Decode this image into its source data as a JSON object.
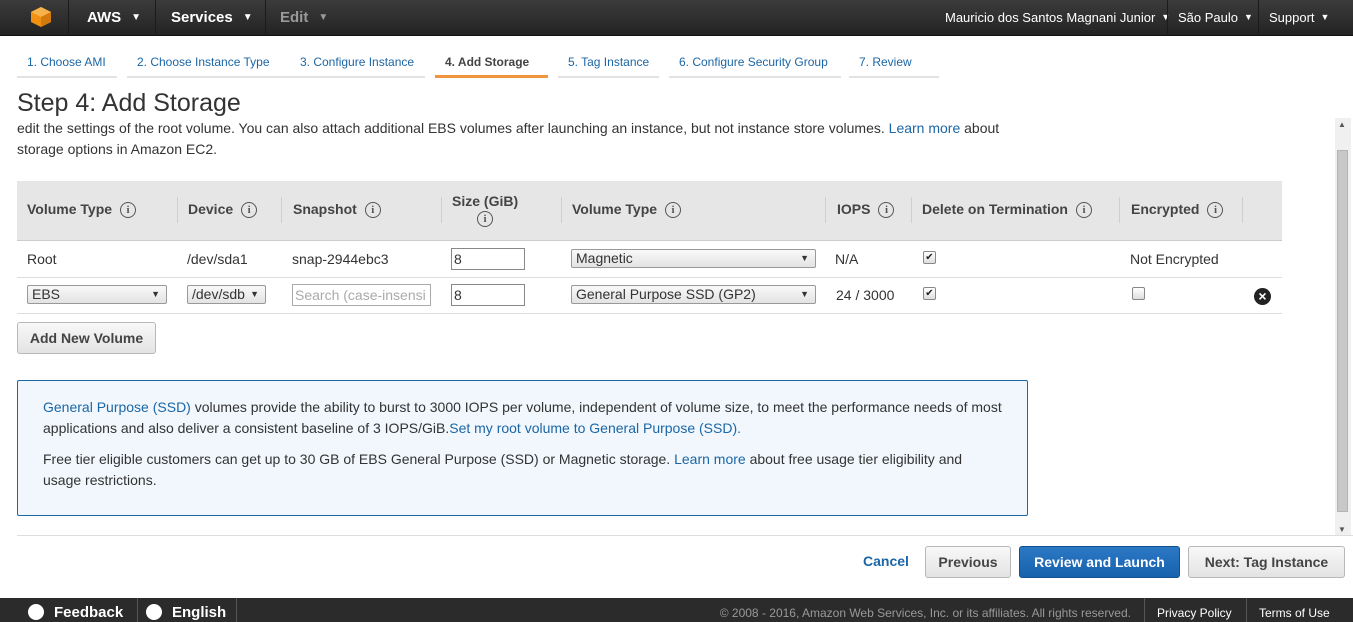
{
  "topnav": {
    "aws_label": "AWS",
    "services_label": "Services",
    "edit_label": "Edit",
    "user_label": "Mauricio dos Santos Magnani Junior",
    "region_label": "São Paulo",
    "support_label": "Support"
  },
  "tabs": [
    {
      "label": "1. Choose AMI"
    },
    {
      "label": "2. Choose Instance Type"
    },
    {
      "label": "3. Configure Instance"
    },
    {
      "label": "4. Add Storage"
    },
    {
      "label": "5. Tag Instance"
    },
    {
      "label": "6. Configure Security Group"
    },
    {
      "label": "7. Review"
    }
  ],
  "page_title": "Step 4: Add Storage",
  "description": {
    "text1": "edit the settings of the root volume. You can also attach additional EBS volumes after launching an instance, but not instance store volumes.",
    "link": "Learn more",
    "text2": "about storage options in Amazon EC2."
  },
  "table": {
    "headers": {
      "volume_type": "Volume Type",
      "device": "Device",
      "snapshot": "Snapshot",
      "size": "Size (GiB)",
      "volume_type2": "Volume Type",
      "iops": "IOPS",
      "delete_on_termination": "Delete on Termination",
      "encrypted": "Encrypted"
    },
    "info_glyph": "i",
    "rows": [
      {
        "volume_type": "Root",
        "device": "/dev/sda1",
        "snapshot": "snap-2944ebc3",
        "size": "8",
        "ebs_type": "Magnetic",
        "iops": "N/A",
        "delete_on_termination": true,
        "encrypted": "Not Encrypted"
      },
      {
        "volume_type": "EBS",
        "device": "/dev/sdb",
        "snapshot_placeholder": "Search (case-insensi",
        "size": "8",
        "ebs_type": "General Purpose SSD (GP2)",
        "iops": "24 / 3000",
        "delete_on_termination": true,
        "encrypted": false
      }
    ],
    "check_glyph": "✔",
    "remove_glyph": "×"
  },
  "add_volume_label": "Add New Volume",
  "infobox": {
    "p1_link": "General Purpose (SSD)",
    "p1_text": "volumes provide the ability to burst to 3000 IOPS per volume, independent of volume size, to meet the performance needs of most applications and also deliver a consistent baseline of 3 IOPS/GiB.",
    "p1_link2": "Set my root volume to General Purpose (SSD).",
    "p2_text": "Free tier eligible customers can get up to 30 GB of EBS General Purpose (SSD) or Magnetic storage.",
    "p2_link": "Learn more",
    "p2_text2": "about free usage tier eligibility and usage restrictions."
  },
  "actions": {
    "cancel": "Cancel",
    "previous": "Previous",
    "review": "Review and Launch",
    "next": "Next: Tag Instance"
  },
  "footer": {
    "feedback": "Feedback",
    "language": "English",
    "copyright": "© 2008 - 2016, Amazon Web Services, Inc. or its affiliates. All rights reserved.",
    "privacy": "Privacy Policy",
    "terms": "Terms of Use"
  },
  "colors": {
    "link": "#1b66a6",
    "primary_button": "#1862ad",
    "active_tab_underline": "#f0953b",
    "topnav_bg": "#232323"
  }
}
